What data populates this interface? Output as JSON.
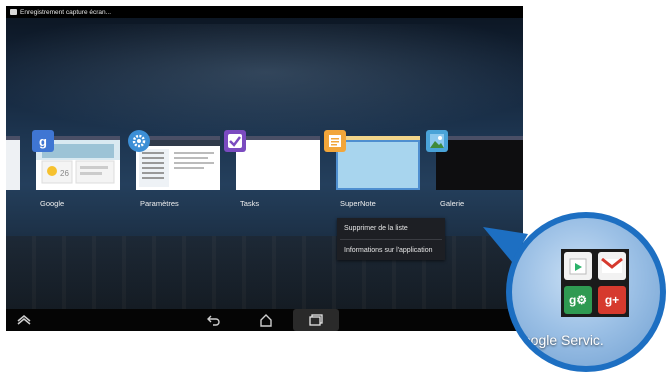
{
  "status_bar": {
    "notification_text": "Enregistrement capture écran..."
  },
  "recent_apps": [
    {
      "label": "Google",
      "icon": "google-search-icon",
      "color": "#3f76d3"
    },
    {
      "label": "Paramètres",
      "icon": "settings-gear-icon",
      "color": "#3c8fd6"
    },
    {
      "label": "Tasks",
      "icon": "tasks-check-icon",
      "color": "#7b4bc0"
    },
    {
      "label": "SuperNote",
      "icon": "supernote-notepad-icon",
      "color": "#f2a63a"
    },
    {
      "label": "Galerie",
      "icon": "gallery-image-icon",
      "color": "#4aa3d8"
    }
  ],
  "context_menu": {
    "items": [
      "Supprimer de la liste",
      "Informations sur l'application"
    ]
  },
  "navigation": {
    "buttons": [
      "up-arrow-icon",
      "back-icon",
      "home-icon",
      "recent-apps-icon"
    ]
  },
  "zoom_callout": {
    "label": "Google Servic.",
    "apps": [
      {
        "icon": "play-store-icon",
        "color": "#f2f2f2"
      },
      {
        "icon": "gmail-icon",
        "color": "#f2f2f2"
      },
      {
        "icon": "google-settings-icon",
        "color": "#2f9a52"
      },
      {
        "icon": "google-plus-icon",
        "color": "#d63a2e"
      }
    ]
  }
}
